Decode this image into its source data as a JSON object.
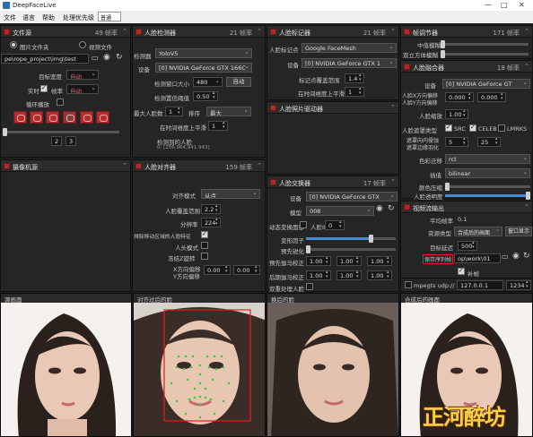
{
  "app": {
    "title": "DeepFaceLive",
    "window_controls": [
      "—",
      "□",
      "✕"
    ]
  },
  "menu": {
    "file": "文件",
    "language": "语言",
    "help": "帮助",
    "process_priority": "处理优先级",
    "priority_value": "普通"
  },
  "file_source": {
    "title": "文件源",
    "fps": "49 帧率",
    "radio_image_folder": "图片文件夹",
    "radio_video_file": "视频文件",
    "path": "pe\\rope_project\\img\\test",
    "target_width_label": "目标宽度",
    "target_width_value": "自动",
    "realtime_label": "实时",
    "fps_label": "帧率",
    "fps_value": "自动",
    "loop_label": "循环播放",
    "frame_current": "2",
    "frame_total": "3"
  },
  "camera_source": {
    "title": "摄像机源"
  },
  "face_detector": {
    "title": "人脸检测器",
    "fps": "21 帧率",
    "detector_label": "检测器",
    "detector_value": "YoloV5",
    "device_label": "设备",
    "device_value": "[0] NVIDIA GeForce GTX 166C",
    "window_size_label": "检测窗口大小",
    "window_size_value": "480",
    "auto_label": "自动",
    "threshold_label": "检测置信阈值",
    "threshold_value": "0.50",
    "max_faces_label": "最大人脸数",
    "max_faces_value": "1",
    "sort_label": "排序",
    "sort_value": "最大",
    "temporal_label": "在时间维度上平滑",
    "temporal_value": "1",
    "detected_label": "检测到的人脸",
    "detected_value": "0: [256.964,941.943]"
  },
  "face_aligner": {
    "title": "人脸对齐器",
    "fps": "159 帧率",
    "align_mode_label": "对齐模式",
    "align_mode_value": "从点",
    "coverage_label": "人脸覆盖范围",
    "coverage_value": "2.2",
    "resolution_label": "分辨率",
    "resolution_value": "224",
    "exclude_moving_label": "排除移动区域的人脸特征",
    "head_mode_label": "人头模式",
    "freeze_z_label": "冻结Z旋转",
    "x_offset_label": "X方向偏移",
    "y_offset_label": "Y方向偏移",
    "x_offset_value": "0.00",
    "y_offset_value": "0.00"
  },
  "face_marker": {
    "title": "人脸标记器",
    "fps": "21 帧率",
    "marker_label": "人脸标记点",
    "marker_value": "Google FaceMesh",
    "device_label": "设备",
    "device_value": "[0] NVIDIA GeForce GTX 1",
    "marker_coverage_label": "标记点覆盖范围",
    "marker_coverage_value": "1.4",
    "temporal_label": "在时间维度上平滑",
    "temporal_value": "1"
  },
  "face_animator": {
    "title": "人脸照片驱动器"
  },
  "face_swapper": {
    "title": "人脸交换器",
    "fps": "17 帧率",
    "device_label": "设备",
    "device_value": "[0] NVIDIA GeForce GTX",
    "model_label": "模型",
    "model_value": "008",
    "animate_label": "动态变换面部",
    "face_id_label": "人脸ID",
    "face_id_value": "0",
    "morph_label": "变形因子",
    "presharpen_label": "预先锐化",
    "pre_gamma_label": "预先伽马校正",
    "post_gamma_label": "后期伽马校正",
    "gamma_r": "1.00",
    "gamma_g": "1.00",
    "gamma_b": "1.00",
    "two_pass_label": "双重处理人脸"
  },
  "frame_adjuster": {
    "title": "帧调节器",
    "fps": "171 帧率",
    "median_label": "中值模糊",
    "degrade_label": "双立方体模糊"
  },
  "face_merger": {
    "title": "人脸融合器",
    "fps": "18 帧率",
    "device_label": "设备",
    "device_value": "[0] NVIDIA GeForce GT",
    "x_offset_label": "人脸X方向偏移",
    "x_offset_value": "0.000",
    "y_offset_label": "人脸Y方向偏移",
    "y_offset_value": "0.000",
    "scale_label": "人脸缩放",
    "scale_value": "1.00",
    "mask_type_label": "人脸遮罩类型",
    "mask_src": "SRC",
    "mask_celeb": "CELEB",
    "mask_lmrks": "LMRKS",
    "erode_label": "遮罩向内侵蚀",
    "erode_value": "5",
    "blur_label": "遮罩边缘羽化",
    "blur_value": "25",
    "color_transfer_label": "色彩迁移",
    "color_transfer_value": "rct",
    "interpolation_label": "插值",
    "interpolation_value": "bilinear",
    "color_compress_label": "颜色压缩",
    "opacity_label": "人脸透明度"
  },
  "stream_output": {
    "title": "视频流输出",
    "avg_fps_label": "平均帧率",
    "avg_fps_value": "0.1",
    "source_label": "资源类型",
    "source_value": "合成后的画面",
    "window_btn": "窗口显示",
    "target_delay_label": "目标延迟",
    "target_delay_value": "500",
    "save_seq_label": "保存序列帧",
    "save_path": "op\\work\\01",
    "fill_gaps_label": "补帧",
    "mpegts_label": "mpegts udp://",
    "udp_host": "127.0.0.1",
    "udp_port": "1234"
  },
  "views": {
    "source_frame": "源画面",
    "aligned_face": "对齐过后的脸",
    "swapped_face": "换后的脸",
    "merged_frame": "合成后的画面"
  },
  "watermark": "正河醉坊"
}
